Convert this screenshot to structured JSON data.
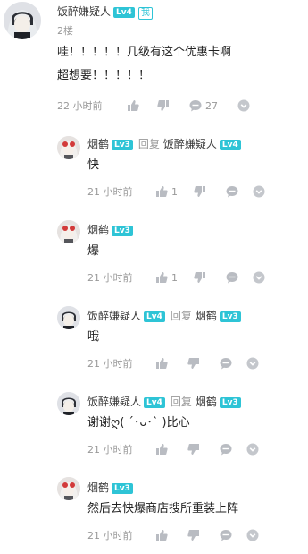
{
  "main_comment": {
    "user": "饭醉嫌疑人",
    "level": "Lv4",
    "me_badge": "我",
    "floor": "2楼",
    "text_line1": "哇！！！！！几级有这个优惠卡啊",
    "text_line2": "超想要！！！！！",
    "time": "22 小时前",
    "comment_count": "27"
  },
  "replies": [
    {
      "user": "烟鹤",
      "level": "Lv3",
      "reply_word": "回复",
      "target": "饭醉嫌疑人",
      "target_level": "Lv4",
      "text": "快",
      "time": "21 小时前",
      "like_count": "1"
    },
    {
      "user": "烟鹤",
      "level": "Lv3",
      "text": "爆",
      "time": "21 小时前",
      "like_count": "1"
    },
    {
      "user": "饭醉嫌疑人",
      "level": "Lv4",
      "reply_word": "回复",
      "target": "烟鹤",
      "target_level": "Lv3",
      "text": "哦",
      "time": "21 小时前"
    },
    {
      "user": "饭醉嫌疑人",
      "level": "Lv4",
      "reply_word": "回复",
      "target": "烟鹤",
      "target_level": "Lv3",
      "text": "谢谢ღ( ´･ᴗ･` )比心",
      "time": "21 小时前"
    },
    {
      "user": "烟鹤",
      "level": "Lv3",
      "text": "然后去快爆商店搜所重装上阵",
      "time": "21 小时前"
    }
  ],
  "colors": {
    "level_badge": "#2ec4d6",
    "meta_gray": "#999999",
    "icon_gray": "#b9bcc2"
  },
  "icons": [
    "thumb-up-icon",
    "thumb-down-icon",
    "comment-bubble-icon",
    "chevron-down-icon"
  ]
}
